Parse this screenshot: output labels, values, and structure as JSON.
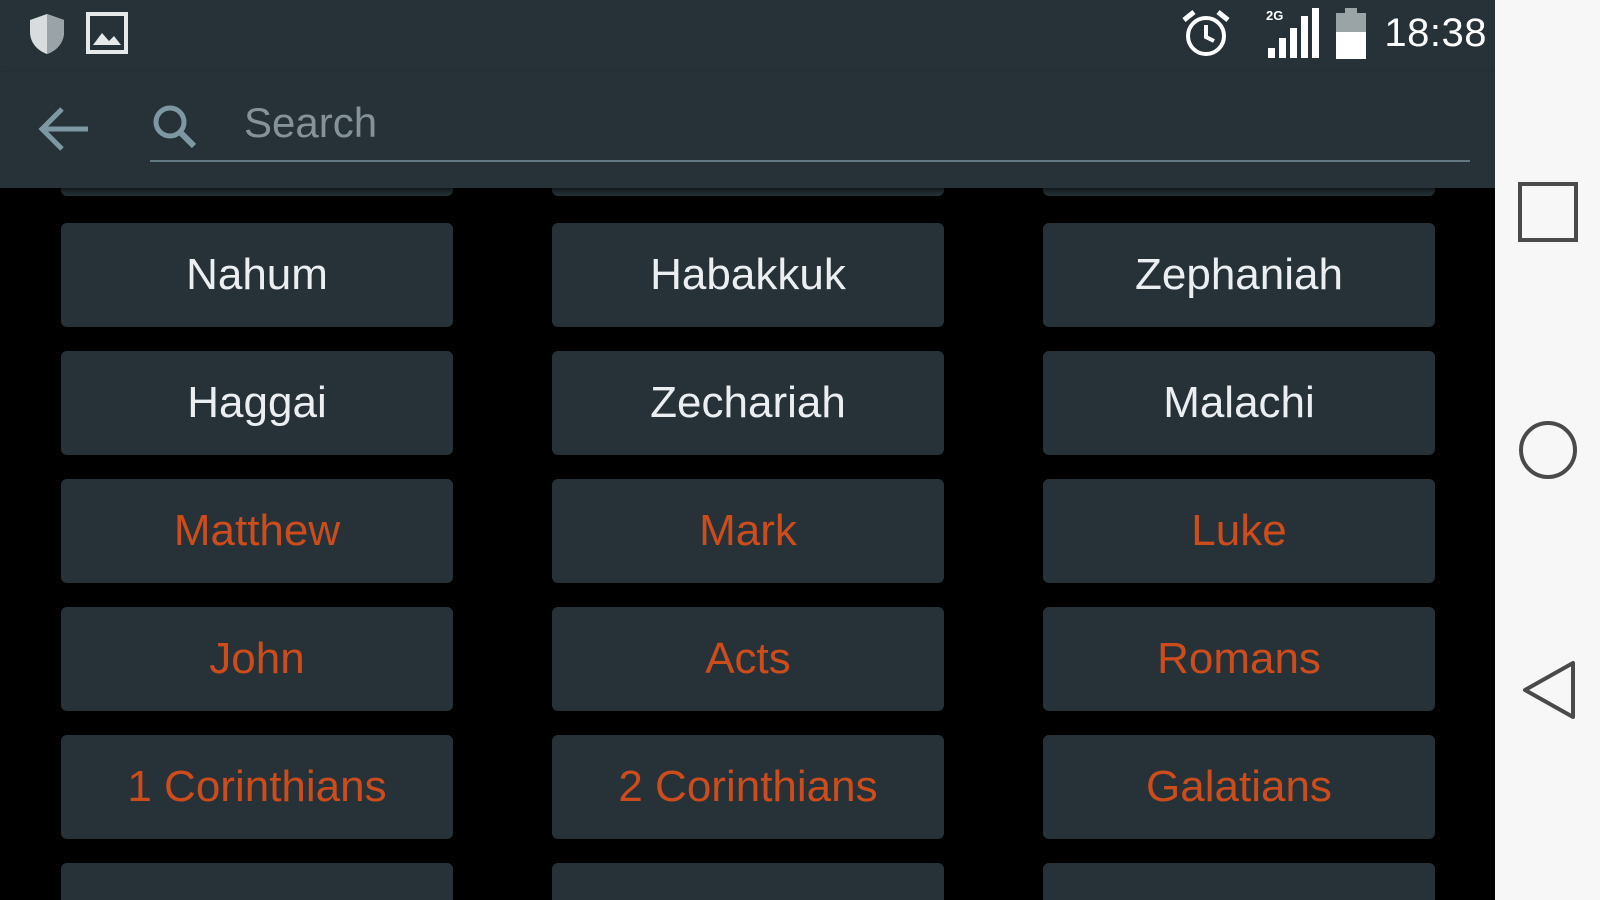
{
  "status_bar": {
    "time": "18:38",
    "network_type": "2G",
    "icons": [
      "shield-icon",
      "image-icon",
      "alarm-icon",
      "signal-icon",
      "battery-icon"
    ]
  },
  "app_bar": {
    "search_placeholder": "Search",
    "search_value": ""
  },
  "books": {
    "rows": [
      [
        {
          "name": "Nahum",
          "testament": "old"
        },
        {
          "name": "Habakkuk",
          "testament": "old"
        },
        {
          "name": "Zephaniah",
          "testament": "old"
        }
      ],
      [
        {
          "name": "Haggai",
          "testament": "old"
        },
        {
          "name": "Zechariah",
          "testament": "old"
        },
        {
          "name": "Malachi",
          "testament": "old"
        }
      ],
      [
        {
          "name": "Matthew",
          "testament": "new"
        },
        {
          "name": "Mark",
          "testament": "new"
        },
        {
          "name": "Luke",
          "testament": "new"
        }
      ],
      [
        {
          "name": "John",
          "testament": "new"
        },
        {
          "name": "Acts",
          "testament": "new"
        },
        {
          "name": "Romans",
          "testament": "new"
        }
      ],
      [
        {
          "name": "1 Corinthians",
          "testament": "new"
        },
        {
          "name": "2 Corinthians",
          "testament": "new"
        },
        {
          "name": "Galatians",
          "testament": "new"
        }
      ]
    ]
  },
  "colors": {
    "app_bar": "#263238",
    "cell_background": "#263238",
    "old_testament_text": "#eceff1",
    "new_testament_text": "#cc4c1c",
    "nav_bar": "#f7f7f7"
  },
  "nav_bar": {
    "icons": [
      "recent-apps-icon",
      "home-icon",
      "back-nav-icon"
    ]
  }
}
